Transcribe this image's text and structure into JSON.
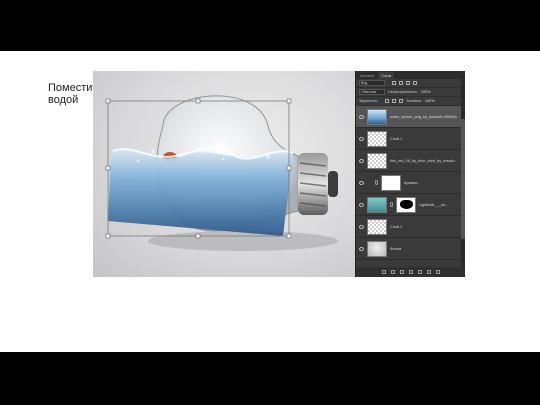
{
  "slide": {
    "title": "Поместите картинку с водой"
  },
  "layers_panel": {
    "tabs": [
      "Каналы",
      "Слои"
    ],
    "kind_label": "Вид",
    "blend_mode": "Обычные",
    "opacity_label": "Непрозрачность:",
    "opacity_value": "100%",
    "lock_label": "Закрепить:",
    "fill_label": "Заливка:",
    "fill_value": "100%",
    "layers": [
      {
        "name": "water_splash_png_by_dawhatt-d5fh5nb",
        "thumb": "water",
        "selected": true
      },
      {
        "name": "Слой 1",
        "thumb": "checker",
        "selected": false
      },
      {
        "name": "fish_red_08_by_blue_dard_by_maxdn...",
        "thumb": "checker",
        "selected": false
      },
      {
        "name": "Кривые...",
        "thumb": "white",
        "selected": false
      },
      {
        "name": "Lightbulb___ph...",
        "thumb": "teal",
        "selected": false
      },
      {
        "name": "Слой 2",
        "thumb": "checker",
        "selected": false
      },
      {
        "name": "Фонов",
        "thumb": "gray",
        "selected": false
      }
    ]
  }
}
